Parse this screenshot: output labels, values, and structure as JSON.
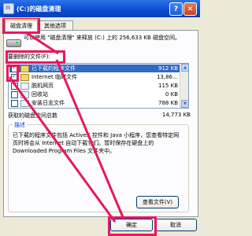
{
  "window": {
    "title": "(C:)的磁盘清理",
    "help_glyph": "?",
    "close_glyph": "✕"
  },
  "tabs": [
    {
      "label": "磁盘清理"
    },
    {
      "label": "其他选项"
    }
  ],
  "intro": {
    "text": "可以使用 \"磁盘清理\" 来释放 (C:) 上的 256,633 KB 磁盘空间。"
  },
  "files": {
    "label": "要删除的文件(F):",
    "items": [
      {
        "name": "已下载的程序文件",
        "size": "912 KB",
        "checked": true
      },
      {
        "name": "Internet 临时文件",
        "size": "13,86…",
        "checked": true
      },
      {
        "name": "脱机网页",
        "size": "115 KB",
        "checked": false
      },
      {
        "name": "回收站",
        "size": "0 KB",
        "checked": false
      },
      {
        "name": "安装日志文件",
        "size": "788 KB",
        "checked": false
      }
    ]
  },
  "total": {
    "label": "获取的磁盘空间总数",
    "value": "14,773 KB"
  },
  "description": {
    "title": "描述",
    "text": "已下载的程序文件包括 ActiveX 控件和 Java 小程序，您查看特定网页时将会从 Internet 自动下载它们。暂时保存在硬盘上的 Downloaded Program Files 文件夹中。"
  },
  "buttons": {
    "view_files": "查看文件(V)",
    "ok": "确定",
    "cancel": "取消"
  },
  "colors": {
    "annotation": "#e8175d",
    "selection": "#316ac5",
    "titlebar": "#0a4bd0"
  },
  "icons": [
    "drive-icon",
    "help-icon",
    "close-icon",
    "checkbox-icon",
    "folder-icon"
  ]
}
